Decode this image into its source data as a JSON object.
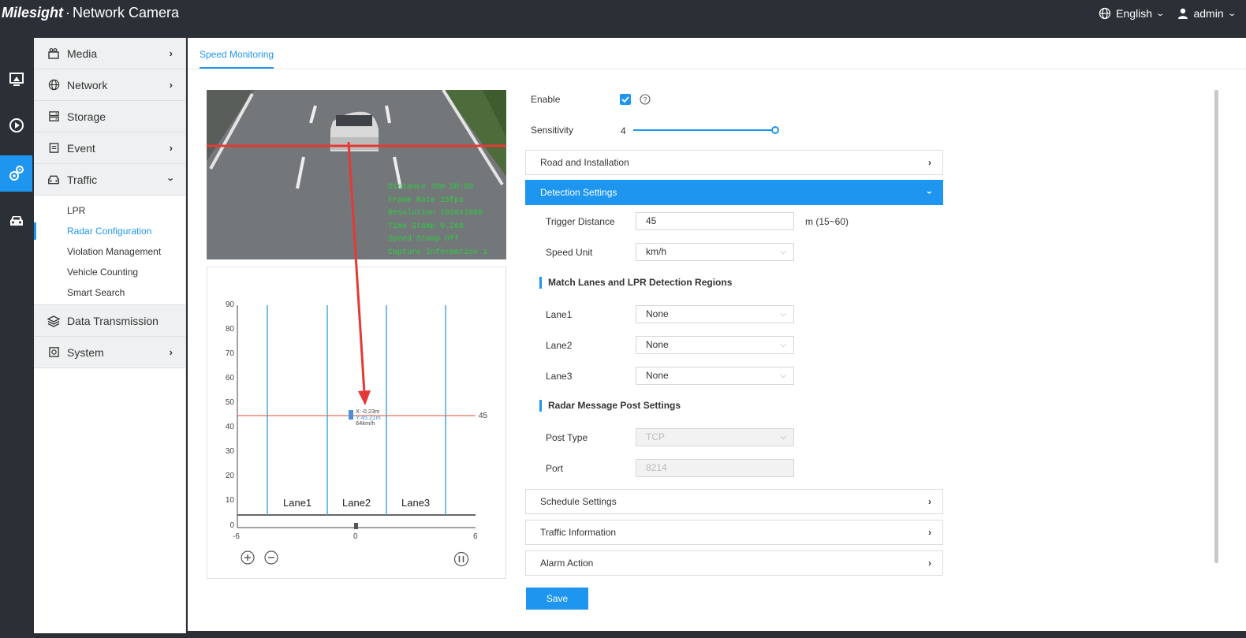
{
  "header": {
    "logo": "Milesight",
    "separator": "·",
    "title": "Network Camera",
    "language": "English",
    "user": "admin"
  },
  "menu": {
    "items": [
      {
        "label": "Media",
        "icon": "media-icon"
      },
      {
        "label": "Network",
        "icon": "globe-icon"
      },
      {
        "label": "Storage",
        "icon": "storage-icon"
      },
      {
        "label": "Event",
        "icon": "event-icon"
      },
      {
        "label": "Traffic",
        "icon": "car-icon"
      }
    ],
    "traffic_sub": [
      "LPR",
      "Radar Configuration",
      "Violation Management",
      "Vehicle Counting",
      "Smart Search"
    ],
    "items_after": [
      {
        "label": "Data Transmission",
        "icon": "layers-icon"
      },
      {
        "label": "System",
        "icon": "system-icon"
      }
    ]
  },
  "tab": "Speed Monitoring",
  "camera_overlay": [
    "Distance  45m  SR:50",
    "Frame Rate  25fps",
    "Resolution  1920x1080",
    "Time Stamp  0.268",
    "Speed Stamp  Off",
    "Capture Information  1"
  ],
  "radar_plot": {
    "y_ticks": [
      "90",
      "80",
      "70",
      "60",
      "50",
      "40",
      "30",
      "20",
      "10",
      "0"
    ],
    "x_ticks": [
      "-6",
      "0",
      "6"
    ],
    "lanes": [
      "Lane1",
      "Lane2",
      "Lane3"
    ],
    "trigger_label": "45",
    "target_x": "X:-0.23m",
    "target_y": "Y:45.21m",
    "target_speed": "64km/h"
  },
  "form": {
    "enable_label": "Enable",
    "enable_checked": true,
    "sensitivity_label": "Sensitivity",
    "sensitivity_value": "4",
    "sensitivity_fraction": 1.0,
    "road_panel": "Road and Installation",
    "detection_panel": "Detection Settings",
    "trigger_distance_label": "Trigger Distance",
    "trigger_distance_value": "45",
    "trigger_distance_unit": "m (15~60)",
    "speed_unit_label": "Speed Unit",
    "speed_unit_value": "km/h",
    "match_section": "Match Lanes and LPR Detection Regions",
    "lanes": [
      {
        "label": "Lane1",
        "value": "None"
      },
      {
        "label": "Lane2",
        "value": "None"
      },
      {
        "label": "Lane3",
        "value": "None"
      }
    ],
    "post_section": "Radar Message Post Settings",
    "post_type_label": "Post Type",
    "post_type_value": "TCP",
    "port_label": "Port",
    "port_value": "8214",
    "schedule_panel": "Schedule Settings",
    "traffic_panel": "Traffic Information",
    "alarm_panel": "Alarm Action",
    "save": "Save"
  },
  "colors": {
    "accent": "#1e96f0",
    "topbar": "#2b3036",
    "trigger_line": "#e53935"
  }
}
